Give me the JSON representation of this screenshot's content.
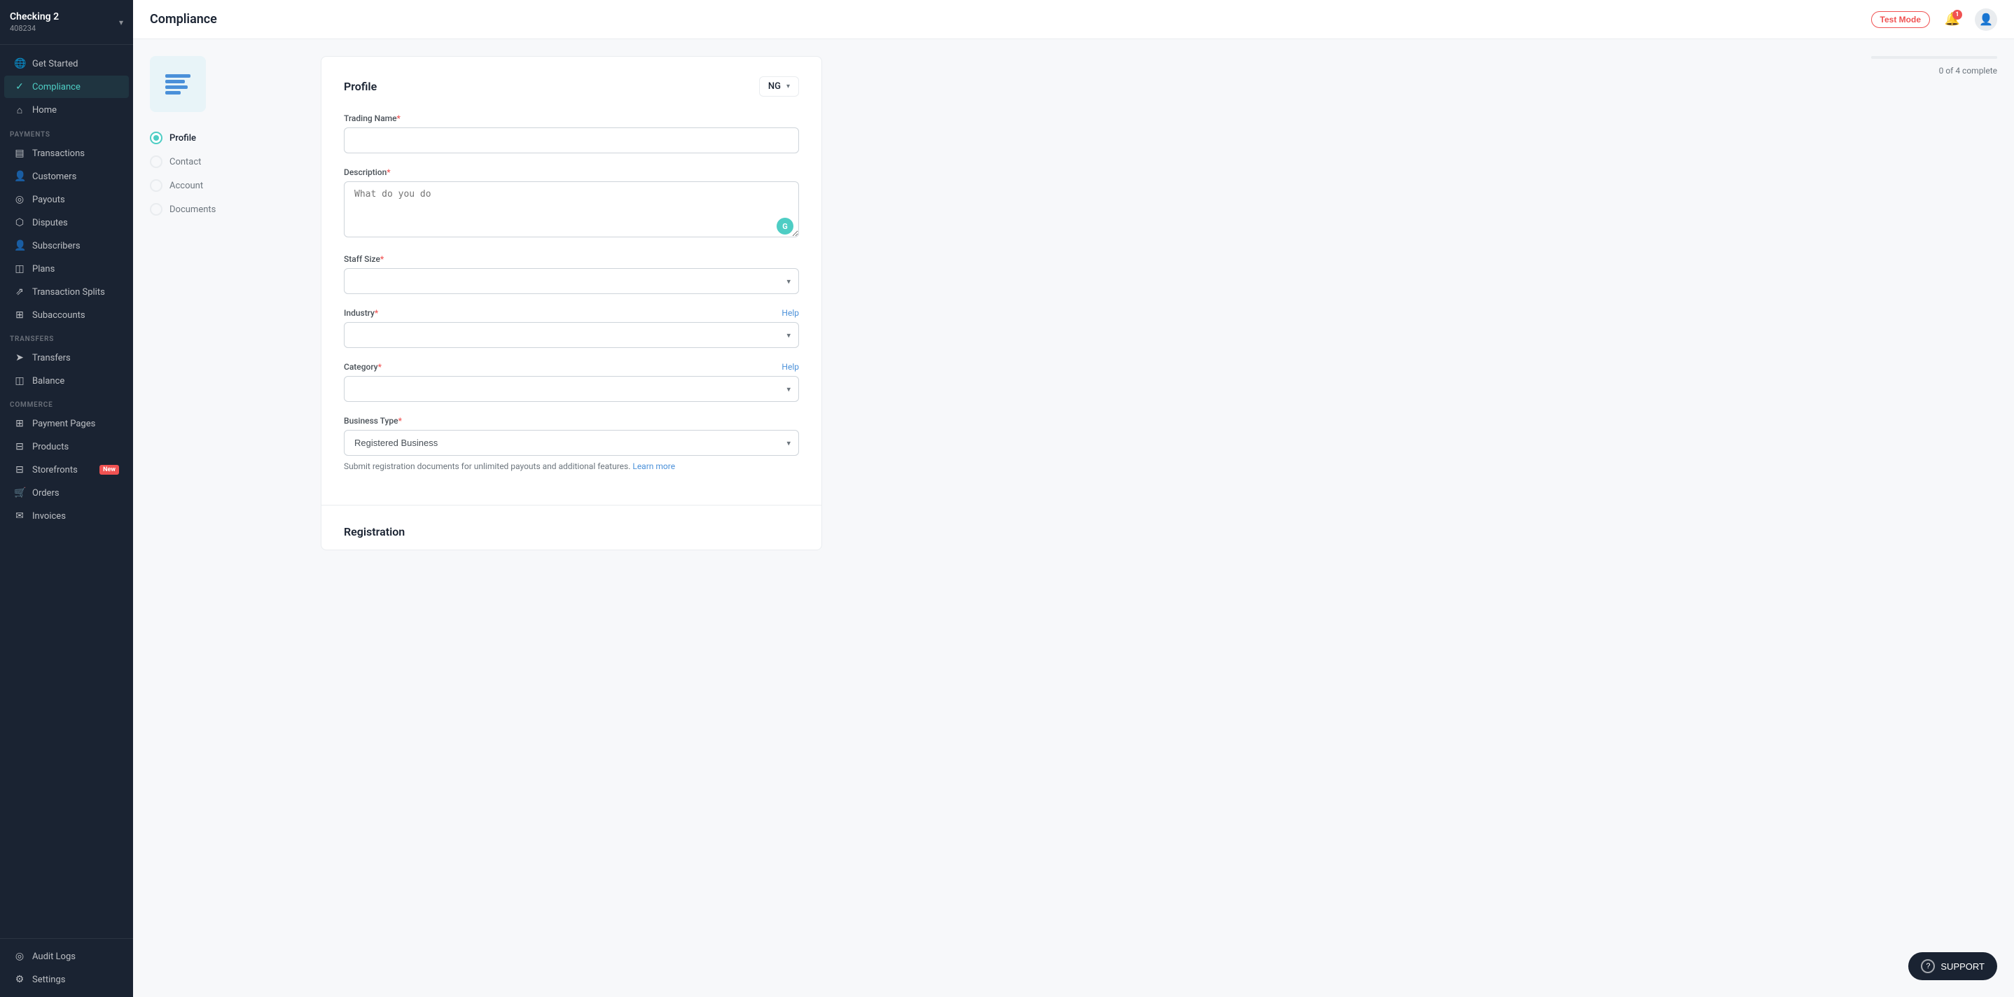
{
  "sidebar": {
    "account": {
      "name": "Checking 2",
      "id": "408234",
      "chevron": "▾"
    },
    "top_items": [
      {
        "id": "get-started",
        "label": "Get Started",
        "icon": "🌐",
        "active": false
      },
      {
        "id": "compliance",
        "label": "Compliance",
        "icon": "✓",
        "active": true
      },
      {
        "id": "home",
        "label": "Home",
        "icon": "⌂",
        "active": false
      }
    ],
    "payments_section": "PAYMENTS",
    "payments_items": [
      {
        "id": "transactions",
        "label": "Transactions",
        "icon": "▤"
      },
      {
        "id": "customers",
        "label": "Customers",
        "icon": "👤"
      },
      {
        "id": "payouts",
        "label": "Payouts",
        "icon": "◎"
      },
      {
        "id": "disputes",
        "label": "Disputes",
        "icon": "⬡"
      },
      {
        "id": "subscribers",
        "label": "Subscribers",
        "icon": "👤"
      },
      {
        "id": "plans",
        "label": "Plans",
        "icon": "◫"
      },
      {
        "id": "transaction-splits",
        "label": "Transaction Splits",
        "icon": "⇗"
      },
      {
        "id": "subaccounts",
        "label": "Subaccounts",
        "icon": "⊞"
      }
    ],
    "transfers_section": "TRANSFERS",
    "transfers_items": [
      {
        "id": "transfers",
        "label": "Transfers",
        "icon": "➤"
      },
      {
        "id": "balance",
        "label": "Balance",
        "icon": "◫"
      }
    ],
    "commerce_section": "COMMERCE",
    "commerce_items": [
      {
        "id": "payment-pages",
        "label": "Payment Pages",
        "icon": "⊞"
      },
      {
        "id": "products",
        "label": "Products",
        "icon": "⊟"
      },
      {
        "id": "storefronts",
        "label": "Storefronts",
        "icon": "⊟",
        "badge": "New"
      },
      {
        "id": "orders",
        "label": "Orders",
        "icon": "🛒"
      },
      {
        "id": "invoices",
        "label": "Invoices",
        "icon": "✉"
      }
    ],
    "bottom_items": [
      {
        "id": "audit-logs",
        "label": "Audit Logs",
        "icon": "◎"
      },
      {
        "id": "settings",
        "label": "Settings",
        "icon": "⚙"
      }
    ]
  },
  "header": {
    "title": "Compliance",
    "test_mode": "Test Mode",
    "notifications_count": "1",
    "bell_icon": "🔔"
  },
  "progress": {
    "label": "0 of 4 complete",
    "percent": 0
  },
  "compliance": {
    "steps": [
      {
        "id": "profile",
        "label": "Profile",
        "active": true
      },
      {
        "id": "contact",
        "label": "Contact",
        "active": false
      },
      {
        "id": "account",
        "label": "Account",
        "active": false
      },
      {
        "id": "documents",
        "label": "Documents",
        "active": false
      }
    ],
    "form": {
      "section_title": "Profile",
      "country": "NG",
      "country_chevron": "▾",
      "trading_name_label": "Trading Name",
      "trading_name_required": "*",
      "trading_name_placeholder": "",
      "description_label": "Description",
      "description_required": "*",
      "description_placeholder": "What do you do",
      "description_ai_label": "G",
      "staff_size_label": "Staff Size",
      "staff_size_required": "*",
      "staff_size_placeholder": "",
      "industry_label": "Industry",
      "industry_required": "*",
      "industry_help": "Help",
      "industry_placeholder": "",
      "category_label": "Category",
      "category_required": "*",
      "category_help": "Help",
      "category_placeholder": "",
      "business_type_label": "Business Type",
      "business_type_required": "*",
      "business_type_value": "Registered Business",
      "business_type_help_text": "Submit registration documents for unlimited payouts and additional features.",
      "learn_more_label": "Learn more"
    },
    "registration_section": {
      "title": "Registration"
    }
  },
  "support": {
    "label": "SUPPORT",
    "icon": "?"
  }
}
